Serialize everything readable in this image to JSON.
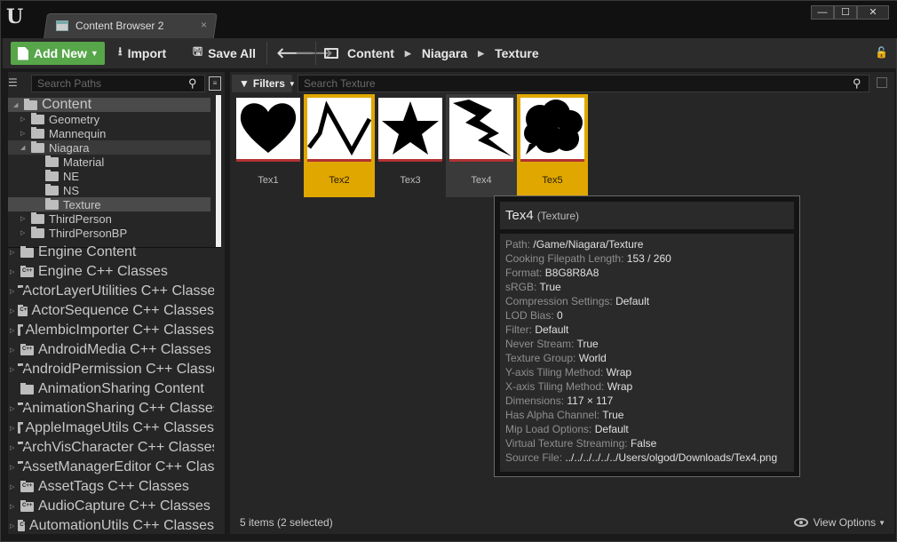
{
  "window": {
    "tab_label": "Content Browser 2",
    "tab_close": "×",
    "logo": "U",
    "minimize": "—",
    "maximize": "☐",
    "close": "✕"
  },
  "toolbar": {
    "add_new": "Add New",
    "import": "Import",
    "save_all": "Save All",
    "breadcrumbs": [
      "Content",
      "Niagara",
      "Texture"
    ]
  },
  "paths": {
    "search_placeholder": "Search Paths",
    "tree": [
      {
        "label": "Content",
        "level": 0,
        "big": true,
        "expanded": true,
        "state": "sel"
      },
      {
        "label": "Geometry",
        "level": 1,
        "expanded": false
      },
      {
        "label": "Mannequin",
        "level": 1,
        "expanded": false
      },
      {
        "label": "Niagara",
        "level": 1,
        "expanded": true,
        "state": "hl"
      },
      {
        "label": "Material",
        "level": 2
      },
      {
        "label": "NE",
        "level": 2
      },
      {
        "label": "NS",
        "level": 2
      },
      {
        "label": "Texture",
        "level": 2,
        "state": "sel"
      },
      {
        "label": "ThirdPerson",
        "level": 1,
        "expanded": false
      },
      {
        "label": "ThirdPersonBP",
        "level": 1,
        "expanded": false
      }
    ],
    "roots": [
      {
        "label": "Engine Content",
        "cpp": false
      },
      {
        "label": "Engine C++ Classes",
        "cpp": true
      },
      {
        "label": "ActorLayerUtilities C++ Classes",
        "cpp": true
      },
      {
        "label": "ActorSequence C++ Classes",
        "cpp": true
      },
      {
        "label": "AlembicImporter C++ Classes",
        "cpp": true
      },
      {
        "label": "AndroidMedia C++ Classes",
        "cpp": true
      },
      {
        "label": "AndroidPermission C++ Classes",
        "cpp": true
      },
      {
        "label": "AnimationSharing Content",
        "cpp": false,
        "noarrow": true
      },
      {
        "label": "AnimationSharing C++ Classes",
        "cpp": true
      },
      {
        "label": "AppleImageUtils C++ Classes",
        "cpp": true
      },
      {
        "label": "ArchVisCharacter C++ Classes",
        "cpp": true
      },
      {
        "label": "AssetManagerEditor C++ Classes",
        "cpp": true
      },
      {
        "label": "AssetTags C++ Classes",
        "cpp": true
      },
      {
        "label": "AudioCapture C++ Classes",
        "cpp": true
      },
      {
        "label": "AutomationUtils C++ Classes",
        "cpp": true
      }
    ]
  },
  "assets": {
    "filters_label": "Filters",
    "search_placeholder": "Search Texture",
    "tiles": [
      {
        "name": "Tex1",
        "shape": "heart",
        "state": ""
      },
      {
        "name": "Tex2",
        "shape": "zigzag",
        "state": "sel"
      },
      {
        "name": "Tex3",
        "shape": "star",
        "state": ""
      },
      {
        "name": "Tex4",
        "shape": "bolt",
        "state": "hov"
      },
      {
        "name": "Tex5",
        "shape": "cloud",
        "state": "sel"
      }
    ],
    "status": "5 items (2 selected)",
    "view_options": "View Options"
  },
  "tooltip": {
    "name": "Tex4",
    "class": "(Texture)",
    "props": [
      {
        "k": "Path:",
        "v": "/Game/Niagara/Texture"
      },
      {
        "k": "Cooking Filepath Length:",
        "v": "153 / 260"
      },
      {
        "k": "Format:",
        "v": "B8G8R8A8"
      },
      {
        "k": "sRGB:",
        "v": "True"
      },
      {
        "k": "Compression Settings:",
        "v": "Default"
      },
      {
        "k": "LOD Bias:",
        "v": "0"
      },
      {
        "k": "Filter:",
        "v": "Default"
      },
      {
        "k": "Never Stream:",
        "v": "True"
      },
      {
        "k": "Texture Group:",
        "v": "World"
      },
      {
        "k": "Y-axis Tiling Method:",
        "v": "Wrap"
      },
      {
        "k": "X-axis Tiling Method:",
        "v": "Wrap"
      },
      {
        "k": "Dimensions:",
        "v": "117 × 117"
      },
      {
        "k": "Has Alpha Channel:",
        "v": "True"
      },
      {
        "k": "Mip Load Options:",
        "v": "Default"
      },
      {
        "k": "Virtual Texture Streaming:",
        "v": "False"
      },
      {
        "k": "Source File:",
        "v": "../../../../../../Users/olgod/Downloads/Tex4.png"
      }
    ]
  }
}
